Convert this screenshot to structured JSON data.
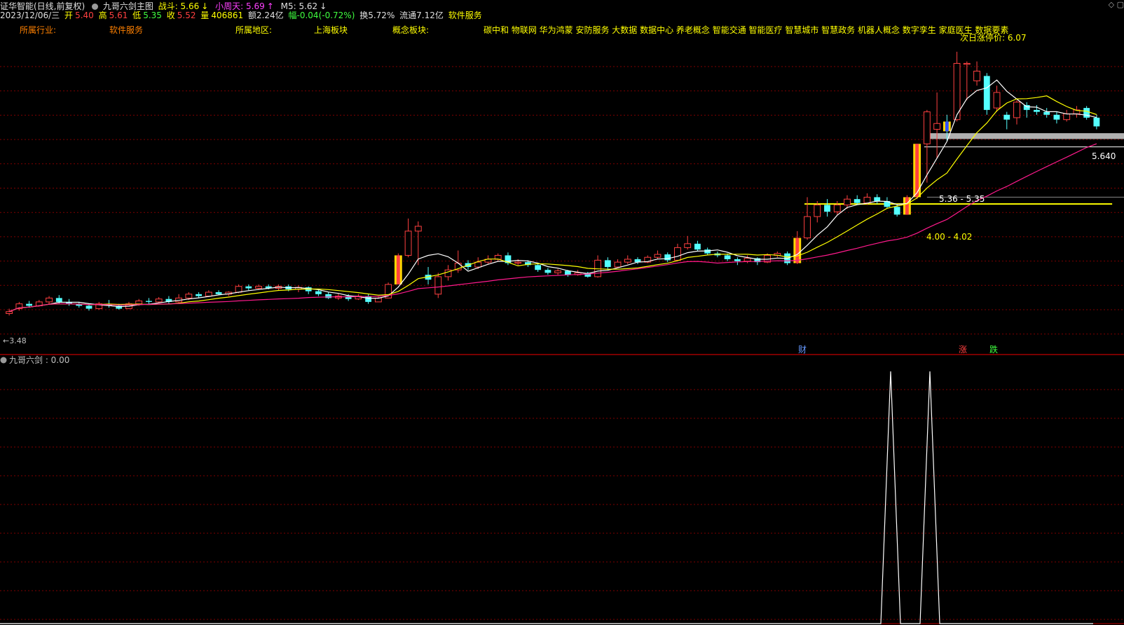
{
  "header": {
    "title": "证华智能(日线,前复权)",
    "indicator_name": "九哥六剑主图",
    "zhandou_label": "战斗: 5.66",
    "zhandou_arrow": "↓",
    "xiaozhoutian_label": "小周天: 5.69",
    "xiaozhoutian_arrow": "↑",
    "m5_label": "M5: 5.62",
    "m5_arrow": "↓"
  },
  "quote": {
    "date": "2023/12/06/三",
    "open_label": "开",
    "open": "5.40",
    "high_label": "高",
    "high": "5.61",
    "low_label": "低",
    "low": "5.35",
    "close_label": "收",
    "close": "5.52",
    "volume_label": "量",
    "volume": "406861",
    "amount": "额2.24亿",
    "change": "幅-0.04(-0.72%)",
    "turnover": "换5.72%",
    "float": "流通7.12亿",
    "sector": "软件服务"
  },
  "infobar": {
    "industry_label": "所属行业:",
    "industry_value": "软件服务",
    "region_label": "所属地区:",
    "region_value": "上海板块",
    "concept_label": "概念板块:",
    "concept_value": "碳中和 物联网 华为鸿蒙 安防服务 大数据 数据中心 养老概念 智能交通 智能医疗 智慧城市 智慧政务 机器人概念 数字孪生 家庭医生 数据要素"
  },
  "annotations": {
    "limit_up_next": "次日涨停价: 6.07",
    "last_price": "5.640",
    "zone_upper": "5.36 - 5.35",
    "zone_lower": "4.00 - 4.02",
    "low_marker": "3.48",
    "marker_cai": "财",
    "marker_zhang": "涨",
    "marker_die": "跌"
  },
  "sub_panel": {
    "title": "九哥六剑 : 0.00"
  },
  "colors": {
    "up": "#ff4040",
    "down": "#54ffff",
    "ma5": "#ffffff",
    "ma10": "#ffff00",
    "ma20": "#ff1a8c",
    "grid": "#800000",
    "zone_grey": "#b0b0b0",
    "zone_yellow": "#ffff00",
    "special_yellow": "#ffd700"
  },
  "chart_data": {
    "type": "candlestick",
    "y_range": [
      3.2,
      6.3
    ],
    "candles": [
      [
        3.5,
        3.52,
        3.55,
        3.48
      ],
      [
        3.55,
        3.6,
        3.62,
        3.53
      ],
      [
        3.6,
        3.58,
        3.63,
        3.56
      ],
      [
        3.58,
        3.62,
        3.64,
        3.57
      ],
      [
        3.62,
        3.66,
        3.68,
        3.6
      ],
      [
        3.66,
        3.62,
        3.69,
        3.6
      ],
      [
        3.62,
        3.6,
        3.65,
        3.58
      ],
      [
        3.6,
        3.58,
        3.62,
        3.56
      ],
      [
        3.58,
        3.55,
        3.6,
        3.53
      ],
      [
        3.55,
        3.6,
        3.62,
        3.54
      ],
      [
        3.6,
        3.58,
        3.64,
        3.56
      ],
      [
        3.58,
        3.55,
        3.6,
        3.54
      ],
      [
        3.55,
        3.6,
        3.62,
        3.55
      ],
      [
        3.6,
        3.63,
        3.65,
        3.58
      ],
      [
        3.63,
        3.62,
        3.66,
        3.6
      ],
      [
        3.62,
        3.65,
        3.67,
        3.61
      ],
      [
        3.65,
        3.62,
        3.68,
        3.6
      ],
      [
        3.62,
        3.66,
        3.7,
        3.61
      ],
      [
        3.66,
        3.7,
        3.72,
        3.64
      ],
      [
        3.7,
        3.68,
        3.72,
        3.66
      ],
      [
        3.68,
        3.72,
        3.74,
        3.67
      ],
      [
        3.72,
        3.7,
        3.74,
        3.69
      ],
      [
        3.7,
        3.72,
        3.73,
        3.68
      ],
      [
        3.72,
        3.78,
        3.8,
        3.71
      ],
      [
        3.78,
        3.76,
        3.8,
        3.74
      ],
      [
        3.76,
        3.78,
        3.8,
        3.75
      ],
      [
        3.78,
        3.76,
        3.8,
        3.75
      ],
      [
        3.76,
        3.78,
        3.8,
        3.74
      ],
      [
        3.78,
        3.75,
        3.8,
        3.73
      ],
      [
        3.75,
        3.77,
        3.79,
        3.72
      ],
      [
        3.77,
        3.73,
        3.78,
        3.7
      ],
      [
        3.73,
        3.7,
        3.75,
        3.68
      ],
      [
        3.7,
        3.66,
        3.72,
        3.65
      ],
      [
        3.66,
        3.68,
        3.71,
        3.64
      ],
      [
        3.68,
        3.65,
        3.7,
        3.63
      ],
      [
        3.65,
        3.68,
        3.7,
        3.64
      ],
      [
        3.68,
        3.62,
        3.7,
        3.6
      ],
      [
        3.62,
        3.66,
        3.68,
        3.62
      ],
      [
        3.66,
        3.8,
        3.82,
        3.66
      ],
      [
        3.8,
        4.1,
        4.12,
        3.8
      ],
      [
        4.1,
        4.35,
        4.48,
        4.08
      ],
      [
        4.35,
        4.4,
        4.45,
        4.0
      ],
      [
        3.9,
        3.85,
        3.98,
        3.8
      ],
      [
        3.7,
        3.88,
        3.92,
        3.66
      ],
      [
        3.88,
        3.95,
        4.0,
        3.84
      ],
      [
        3.95,
        4.02,
        4.15,
        3.92
      ],
      [
        4.02,
        3.98,
        4.05,
        3.95
      ],
      [
        3.98,
        4.03,
        4.08,
        3.96
      ],
      [
        4.03,
        4.06,
        4.1,
        4.01
      ],
      [
        4.06,
        4.1,
        4.12,
        4.04
      ],
      [
        4.1,
        4.02,
        4.13,
        4.0
      ],
      [
        4.02,
        4.03,
        4.06,
        4.0
      ],
      [
        4.03,
        4.0,
        4.05,
        3.98
      ],
      [
        4.0,
        3.95,
        4.02,
        3.93
      ],
      [
        3.95,
        3.92,
        3.97,
        3.9
      ],
      [
        3.92,
        3.94,
        3.96,
        3.9
      ],
      [
        3.94,
        3.9,
        3.95,
        3.88
      ],
      [
        3.9,
        3.92,
        3.95,
        3.89
      ],
      [
        3.92,
        3.88,
        3.93,
        3.87
      ],
      [
        3.88,
        4.05,
        4.1,
        3.87
      ],
      [
        4.05,
        3.98,
        4.08,
        3.95
      ],
      [
        3.98,
        4.03,
        4.06,
        3.97
      ],
      [
        4.03,
        4.06,
        4.1,
        4.01
      ],
      [
        4.06,
        4.03,
        4.08,
        4.01
      ],
      [
        4.03,
        4.08,
        4.1,
        4.02
      ],
      [
        4.08,
        4.11,
        4.15,
        4.06
      ],
      [
        4.11,
        4.05,
        4.13,
        4.03
      ],
      [
        4.05,
        4.18,
        4.22,
        4.04
      ],
      [
        4.18,
        4.22,
        4.3,
        4.16
      ],
      [
        4.22,
        4.16,
        4.25,
        4.14
      ],
      [
        4.16,
        4.12,
        4.18,
        4.1
      ],
      [
        4.12,
        4.1,
        4.14,
        4.08
      ],
      [
        4.1,
        4.06,
        4.12,
        4.04
      ],
      [
        4.06,
        4.04,
        4.08,
        4.0
      ],
      [
        4.04,
        4.07,
        4.1,
        4.02
      ],
      [
        4.07,
        4.03,
        4.08,
        4.0
      ],
      [
        4.03,
        4.1,
        4.12,
        4.02
      ],
      [
        4.1,
        4.12,
        4.14,
        4.08
      ],
      [
        4.12,
        4.02,
        4.14,
        4.0
      ],
      [
        4.02,
        4.28,
        4.35,
        4.01
      ],
      [
        4.28,
        4.5,
        4.7,
        4.26
      ],
      [
        4.5,
        4.62,
        4.66,
        4.44
      ],
      [
        4.62,
        4.55,
        4.68,
        4.5
      ],
      [
        4.55,
        4.62,
        4.66,
        4.52
      ],
      [
        4.62,
        4.68,
        4.72,
        4.58
      ],
      [
        4.68,
        4.64,
        4.72,
        4.62
      ],
      [
        4.64,
        4.7,
        4.74,
        4.62
      ],
      [
        4.7,
        4.66,
        4.73,
        4.63
      ],
      [
        4.66,
        4.6,
        4.7,
        4.58
      ],
      [
        4.6,
        4.52,
        4.62,
        4.5
      ],
      [
        4.52,
        4.7,
        4.72,
        4.52
      ],
      [
        4.7,
        5.25,
        5.25,
        4.68
      ],
      [
        5.25,
        5.58,
        5.6,
        4.85
      ],
      [
        5.4,
        5.46,
        5.78,
        5.1
      ],
      [
        5.48,
        5.38,
        5.55,
        5.28
      ],
      [
        5.5,
        6.08,
        6.2,
        5.48
      ],
      [
        6.07,
        6.08,
        6.1,
        5.7
      ],
      [
        5.9,
        6.0,
        6.1,
        5.85
      ],
      [
        5.95,
        5.6,
        5.98,
        5.55
      ],
      [
        5.62,
        5.78,
        5.85,
        5.58
      ],
      [
        5.55,
        5.5,
        5.58,
        5.4
      ],
      [
        5.52,
        5.68,
        5.7,
        5.45
      ],
      [
        5.65,
        5.6,
        5.68,
        5.52
      ],
      [
        5.6,
        5.58,
        5.65,
        5.55
      ],
      [
        5.58,
        5.55,
        5.62,
        5.52
      ],
      [
        5.55,
        5.5,
        5.58,
        5.46
      ],
      [
        5.5,
        5.56,
        5.6,
        5.48
      ],
      [
        5.56,
        5.6,
        5.64,
        5.52
      ],
      [
        5.62,
        5.52,
        5.64,
        5.5
      ],
      [
        5.52,
        5.43,
        5.55,
        5.4
      ]
    ],
    "sub_peaks": [
      0.0,
      1.0
    ]
  }
}
